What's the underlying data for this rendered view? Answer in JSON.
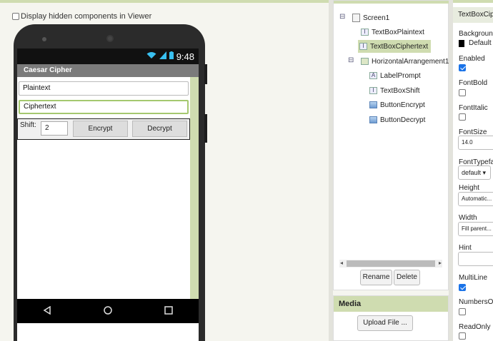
{
  "viewer": {
    "hidden_checkbox_label": "Display hidden components in Viewer",
    "phone": {
      "time": "9:48",
      "app_title": "Caesar Cipher",
      "plaintext_hint": "Plaintext",
      "ciphertext_hint": "Ciphertext",
      "shift_label": "Shift:",
      "shift_value": "2",
      "encrypt_label": "Encrypt",
      "decrypt_label": "Decrypt"
    }
  },
  "components": {
    "tree": [
      {
        "name": "Screen1",
        "icon": "screen-icon"
      },
      {
        "name": "TextBoxPlaintext",
        "icon": "textbox-icon"
      },
      {
        "name": "TextBoxCiphertext",
        "icon": "textbox-icon",
        "selected": true
      },
      {
        "name": "HorizontalArrangement1",
        "icon": "arrangement-icon"
      },
      {
        "name": "LabelPrompt",
        "icon": "label-icon"
      },
      {
        "name": "TextBoxShift",
        "icon": "textbox-icon"
      },
      {
        "name": "ButtonEncrypt",
        "icon": "button-icon"
      },
      {
        "name": "ButtonDecrypt",
        "icon": "button-icon"
      }
    ],
    "rename_label": "Rename",
    "delete_label": "Delete"
  },
  "media": {
    "title": "Media",
    "upload_label": "Upload File ..."
  },
  "properties": {
    "component": "TextBoxCip",
    "background_label": "Backgroun",
    "background_value": "Default",
    "enabled_label": "Enabled",
    "fontbold_label": "FontBold",
    "fontitalic_label": "FontItalic",
    "fontsize_label": "FontSize",
    "fontsize_value": "14.0",
    "fonttypeface_label": "FontTypefac",
    "fonttypeface_value": "default ▾",
    "height_label": "Height",
    "height_value": "Automatic...",
    "width_label": "Width",
    "width_value": "Fill parent...",
    "hint_label": "Hint",
    "hint_value": "",
    "multiline_label": "MultiLine",
    "numbersonly_label": "NumbersOn",
    "readonly_label": "ReadOnly"
  }
}
